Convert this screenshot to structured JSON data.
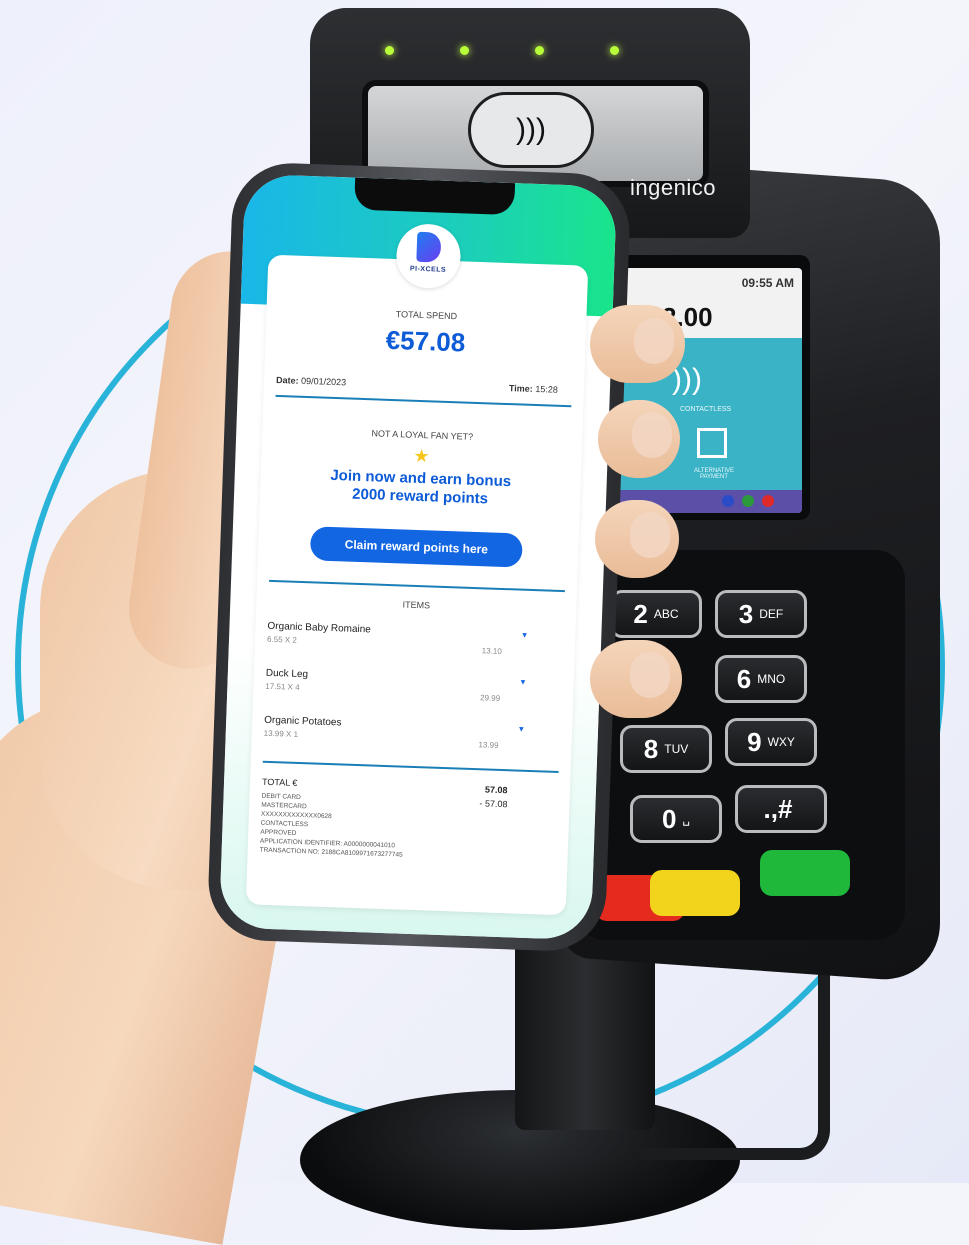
{
  "terminal": {
    "brand": "ingenico",
    "screen_time": "09:55 AM",
    "screen_amount": "2.00",
    "screen_contactless": "CONTACTLESS",
    "screen_alt": "ALTERNATIVE PAYMENT",
    "contactless_symbol": "))) ",
    "keys": [
      {
        "digit": "2",
        "letters": "ABC"
      },
      {
        "digit": "3",
        "letters": "DEF"
      },
      {
        "digit": "6",
        "letters": "MNO"
      },
      {
        "digit": "8",
        "letters": "TUV"
      },
      {
        "digit": "9",
        "letters": "WXY"
      },
      {
        "digit": "0",
        "letters": "␣"
      },
      {
        "digit": ".,#",
        "letters": ""
      }
    ]
  },
  "receipt": {
    "logo_text": "PI-XCELS",
    "total_spend_label": "TOTAL SPEND",
    "total_spend_value": "€57.08",
    "date_label": "Date:",
    "date_value": "09/01/2023",
    "time_label": "Time:",
    "time_value": "15:28",
    "loyal_prompt": "NOT A LOYAL FAN YET?",
    "star": "★",
    "bonus_line1": "Join now and earn bonus",
    "bonus_line2": "2000 reward points",
    "claim_button": "Claim reward points here",
    "items_heading": "ITEMS",
    "items": [
      {
        "name": "Organic Baby Romaine",
        "qty": "6.55 X 2",
        "total": "13.10"
      },
      {
        "name": "Duck Leg",
        "qty": "17.51 X 4",
        "total": "29.99"
      },
      {
        "name": "Organic Potatoes",
        "qty": "13.99 X 1",
        "total": "13.99"
      }
    ],
    "chevron": "▾",
    "total_label": "TOTAL €",
    "total_value": "57.08",
    "payment_amount": "- 57.08",
    "payment_lines": [
      "DEBIT CARD",
      "MASTERCARD",
      "XXXXXXXXXXXXX0628",
      "CONTACTLESS",
      "APPROVED",
      "APPLICATION IDENTIFIER: A0000000041010",
      "TRANSACTION NO: 2188CA8109971673277745"
    ]
  }
}
